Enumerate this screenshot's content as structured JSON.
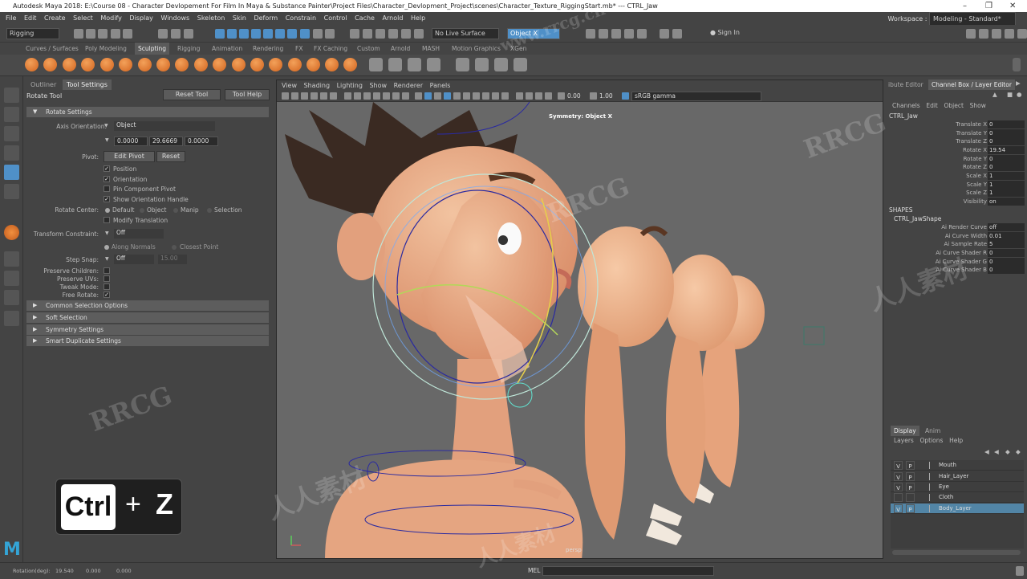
{
  "window": {
    "title": "Autodesk Maya 2018: E:\\Course 08 - Character Devlopement For Film In Maya & Substance Painter\\Project Files\\Character_Devlopment_Project\\scenes\\Character_Texture_RiggingStart.mb*  ---  CTRL_Jaw"
  },
  "menu": [
    "File",
    "Edit",
    "Create",
    "Select",
    "Modify",
    "Display",
    "Windows",
    "Skeleton",
    "Skin",
    "Deform",
    "Constrain",
    "Control",
    "Cache",
    "Arnold",
    "Help"
  ],
  "workspace": {
    "label": "Workspace :",
    "value": "Modeling - Standard*"
  },
  "status": {
    "mode": "Rigging",
    "live_surface": "No Live Surface",
    "symmetry": "Object X",
    "sign_in": "Sign In"
  },
  "shelf_tabs": [
    "Curves / Surfaces",
    "Poly Modeling",
    "Sculpting",
    "Rigging",
    "Animation",
    "Rendering",
    "FX",
    "FX Caching",
    "Custom",
    "Arnold",
    "MASH",
    "Motion Graphics",
    "XGen"
  ],
  "shelf_active": "Sculpting",
  "left_tabs": [
    "Outliner",
    "Tool Settings"
  ],
  "tool": {
    "name": "Rotate Tool",
    "reset": "Reset Tool",
    "help": "Tool Help",
    "rotate_settings": "Rotate Settings",
    "axis_orientation_label": "Axis Orientation:",
    "axis_orientation": "Object",
    "vals": [
      "0.0000",
      "29.6669",
      "0.0000"
    ],
    "pivot_label": "Pivot:",
    "edit_pivot": "Edit Pivot",
    "reset_btn": "Reset",
    "position": "Position",
    "orientation": "Orientation",
    "pin_pivot": "Pin Component Pivot",
    "show_handle": "Show Orientation Handle",
    "rotate_center_label": "Rotate Center:",
    "rc_default": "Default",
    "rc_object": "Object",
    "rc_manip": "Manip",
    "rc_selection": "Selection",
    "modify_translation": "Modify Translation",
    "transform_constraint_label": "Transform Constraint:",
    "transform_constraint": "Off",
    "along_normals": "Along Normals",
    "closest_point": "Closest Point",
    "step_snap_label": "Step Snap:",
    "step_snap": "Off",
    "step_val": "15.00",
    "preserve_children": "Preserve Children:",
    "preserve_uvs": "Preserve UVs:",
    "tweak_mode": "Tweak Mode:",
    "free_rotate": "Free Rotate:",
    "sections": [
      "Common Selection Options",
      "Soft Selection",
      "Symmetry Settings",
      "Smart Duplicate Settings"
    ]
  },
  "shortcut": {
    "key1": "Ctrl",
    "plus": "+",
    "key2": "Z"
  },
  "viewport": {
    "menu": [
      "View",
      "Shading",
      "Lighting",
      "Show",
      "Renderer",
      "Panels"
    ],
    "exposure": "0.00",
    "gamma": "1.00",
    "colorspace": "sRGB gamma",
    "symmetry_label": "Symmetry: Object X",
    "camera": "persp"
  },
  "right_tabs": [
    "ibute Editor",
    "Channel Box / Layer Editor"
  ],
  "channel_menu": [
    "Channels",
    "Edit",
    "Object",
    "Show"
  ],
  "channel_object": "CTRL_Jaw",
  "channels": [
    {
      "name": "Translate X",
      "value": "0"
    },
    {
      "name": "Translate Y",
      "value": "0"
    },
    {
      "name": "Translate Z",
      "value": "0"
    },
    {
      "name": "Rotate X",
      "value": "19.54"
    },
    {
      "name": "Rotate Y",
      "value": "0"
    },
    {
      "name": "Rotate Z",
      "value": "0"
    },
    {
      "name": "Scale X",
      "value": "1"
    },
    {
      "name": "Scale Y",
      "value": "1"
    },
    {
      "name": "Scale Z",
      "value": "1"
    },
    {
      "name": "Visibility",
      "value": "on"
    }
  ],
  "shapes_header": "SHAPES",
  "shape_name": "CTRL_JawShape",
  "shape_attrs": [
    {
      "name": "Ai Render Curve",
      "value": "off"
    },
    {
      "name": "Ai Curve Width",
      "value": "0.01"
    },
    {
      "name": "Ai Sample Rate",
      "value": "5"
    },
    {
      "name": "Ai Curve Shader R",
      "value": "0"
    },
    {
      "name": "Ai Curve Shader G",
      "value": "0"
    },
    {
      "name": "Ai Curve Shader B",
      "value": "0"
    }
  ],
  "layer_tabs": [
    "Display",
    "Anim"
  ],
  "layer_menu": [
    "Layers",
    "Options",
    "Help"
  ],
  "layers": [
    {
      "v": "V",
      "p": "P",
      "name": "Mouth"
    },
    {
      "v": "V",
      "p": "P",
      "name": "Hair_Layer"
    },
    {
      "v": "V",
      "p": "P",
      "name": "Eye"
    },
    {
      "v": "",
      "p": "",
      "name": "Cloth"
    },
    {
      "v": "V",
      "p": "P",
      "name": "Body_Layer"
    }
  ],
  "bottom": {
    "rotation_label": "Rotation(deg):",
    "rx": "19.540",
    "ry": "0.000",
    "rz": "0.000",
    "mel": "MEL"
  },
  "watermarks": {
    "site": "www.rrcg.cn",
    "brand": "RRCG",
    "cn": "人人素材"
  }
}
